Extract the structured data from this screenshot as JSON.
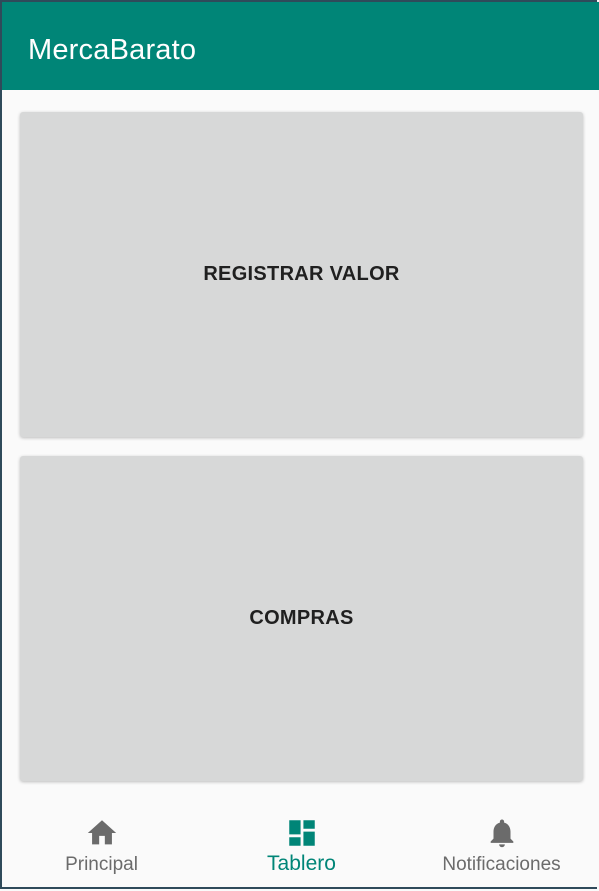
{
  "app_bar": {
    "title": "MercaBarato",
    "color": "#008577"
  },
  "main": {
    "buttons": [
      {
        "label": "REGISTRAR VALOR"
      },
      {
        "label": "COMPRAS"
      }
    ]
  },
  "bottom_nav": {
    "items": [
      {
        "label": "Principal",
        "icon": "home-icon",
        "active": false
      },
      {
        "label": "Tablero",
        "icon": "dashboard-icon",
        "active": true
      },
      {
        "label": "Notificaciones",
        "icon": "bell-icon",
        "active": false
      }
    ],
    "active_color": "#008577",
    "inactive_color": "#6b6b6b"
  }
}
